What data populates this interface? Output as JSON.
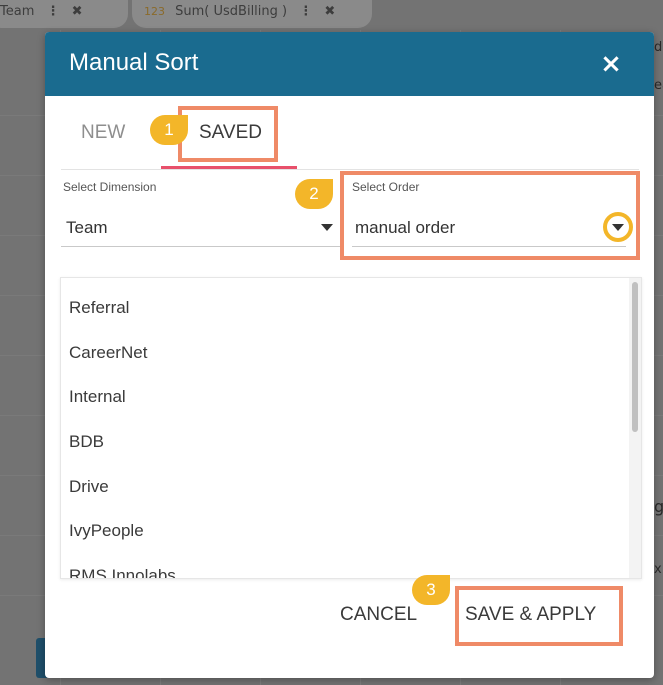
{
  "background": {
    "chip1": "Team",
    "chip2_prefix": "123",
    "chip2": "Sum( UsdBilling )",
    "right_text_1": "d",
    "right_text_2": "ea",
    "right_text_3": "g",
    "right_text_4": "x"
  },
  "dialog": {
    "title": "Manual Sort",
    "close_icon": "×",
    "tabs": [
      {
        "label": "NEW",
        "active": false
      },
      {
        "label": "SAVED",
        "active": true
      }
    ],
    "select_dimension": {
      "label": "Select Dimension",
      "value": "Team"
    },
    "select_order": {
      "label": "Select Order",
      "value": "manual order"
    },
    "items": [
      "Referral",
      "CareerNet",
      "Internal",
      "BDB",
      "Drive",
      "IvyPeople",
      "RMS Innolabs"
    ],
    "cancel_label": "CANCEL",
    "save_apply_label": "SAVE & APPLY"
  },
  "callouts": {
    "step1": "1",
    "step2": "2",
    "step3": "3"
  },
  "colors": {
    "header": "#1a6b8f",
    "highlight": "#ef8a67",
    "badge": "#f3b629",
    "tab_underline": "#e8506b"
  }
}
